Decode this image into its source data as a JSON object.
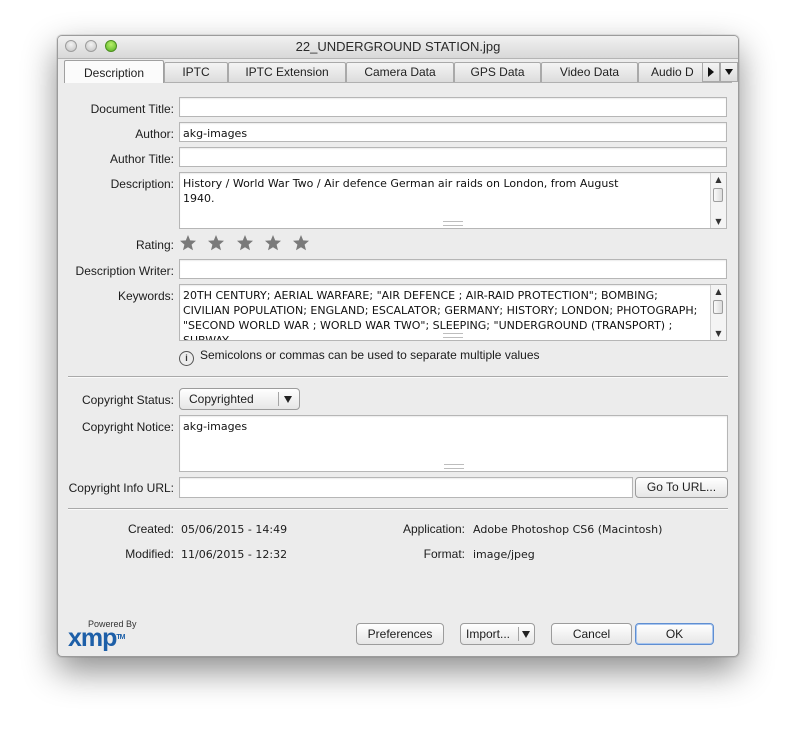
{
  "window": {
    "title": "22_UNDERGROUND STATION.jpg"
  },
  "tabs": [
    {
      "label": "Description"
    },
    {
      "label": "IPTC"
    },
    {
      "label": "IPTC Extension"
    },
    {
      "label": "Camera Data"
    },
    {
      "label": "GPS Data"
    },
    {
      "label": "Video Data"
    },
    {
      "label": "Audio D"
    }
  ],
  "tab_controls": {
    "next_icon": "triangle-right",
    "menu_icon": "triangle-down"
  },
  "form": {
    "document_title": {
      "label": "Document Title:",
      "value": ""
    },
    "author": {
      "label": "Author:",
      "value": "akg-images"
    },
    "author_title": {
      "label": "Author Title:",
      "value": ""
    },
    "description": {
      "label": "Description:",
      "value": "History / World War Two / Air defence German air raids on London, from August 1940."
    },
    "rating": {
      "label": "Rating:",
      "value": 0,
      "max": 5
    },
    "description_writer": {
      "label": "Description Writer:",
      "value": ""
    },
    "keywords": {
      "label": "Keywords:",
      "value": "20TH CENTURY; AERIAL WARFARE; \"AIR DEFENCE ; AIR-RAID PROTECTION\"; BOMBING; CIVILIAN POPULATION; ENGLAND; ESCALATOR; GERMANY; HISTORY; LONDON; PHOTOGRAPH; \"SECOND WORLD WAR ; WORLD WAR TWO\"; SLEEPING; \"UNDERGROUND (TRANSPORT) ; SUBWAY"
    },
    "keywords_hint": "Semicolons or commas can be used to separate multiple values",
    "copyright_status": {
      "label": "Copyright Status:",
      "value": "Copyrighted"
    },
    "copyright_notice": {
      "label": "Copyright Notice:",
      "value": "akg-images"
    },
    "copyright_info_url": {
      "label": "Copyright Info URL:",
      "value": "",
      "button": "Go To URL..."
    }
  },
  "metadata": {
    "created": {
      "label": "Created:",
      "value": "05/06/2015 - 14:49"
    },
    "modified": {
      "label": "Modified:",
      "value": "11/06/2015 - 12:32"
    },
    "application": {
      "label": "Application:",
      "value": "Adobe Photoshop CS6 (Macintosh)"
    },
    "format": {
      "label": "Format:",
      "value": "image/jpeg"
    }
  },
  "footer": {
    "powered_by": "Powered By",
    "logo_text": "xmp",
    "logo_tm": "TM",
    "preferences": "Preferences",
    "import": "Import...",
    "cancel": "Cancel",
    "ok": "OK"
  },
  "colors": {
    "accent": "#5f8ed1",
    "logo": "#1d5fa8",
    "star": "#7a7a7a"
  }
}
